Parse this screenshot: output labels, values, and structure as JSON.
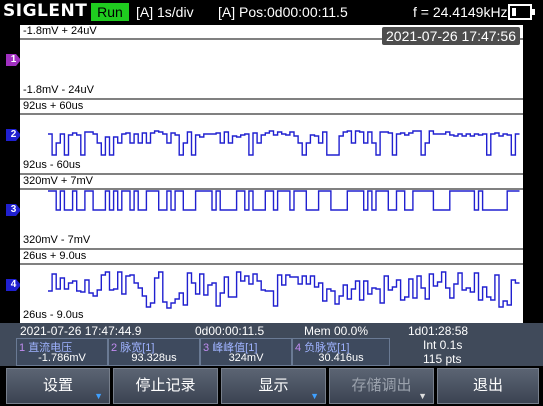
{
  "topbar": {
    "brand": "SIGLENT",
    "run_state": "Run",
    "timebase": "[A] 1s/div",
    "position": "[A] Pos:0d00:00:11.5",
    "frequency": "f = 24.4149kHz"
  },
  "screen": {
    "datetime": "2021-07-26 17:47:56",
    "channels": [
      {
        "marker": "1",
        "upper_label": "-1.8mV + 24uV",
        "lower_label": "-1.8mV - 24uV",
        "color": "#a030c0"
      },
      {
        "marker": "2",
        "upper_label": "92us + 60us",
        "lower_label": "92us - 60us",
        "color": "#2020d0"
      },
      {
        "marker": "3",
        "upper_label": "320mV + 7mV",
        "lower_label": "320mV - 7mV",
        "color": "#2020d0"
      },
      {
        "marker": "4",
        "upper_label": "26us + 9.0us",
        "lower_label": "26us - 9.0us",
        "color": "#2020d0"
      }
    ]
  },
  "status": {
    "start_time": "2021-07-26 17:47:44.9",
    "elapsed": "0d00:00:11.5",
    "mem": "Mem 00.0%",
    "remaining": "1d01:28:58",
    "interval": "Int 0.1s",
    "points": "115 pts",
    "measurements": [
      {
        "num": "1",
        "name": "直流电压",
        "value": "-1.786mV"
      },
      {
        "num": "2",
        "name": "脉宽[1]",
        "value": "93.328us"
      },
      {
        "num": "3",
        "name": "峰峰值[1]",
        "value": "324mV"
      },
      {
        "num": "4",
        "name": "负脉宽[1]",
        "value": "30.416us"
      }
    ]
  },
  "softkeys": [
    "设置",
    "停止记录",
    "显示",
    "存储调出",
    "退出"
  ],
  "trace_color": "#2020d0"
}
